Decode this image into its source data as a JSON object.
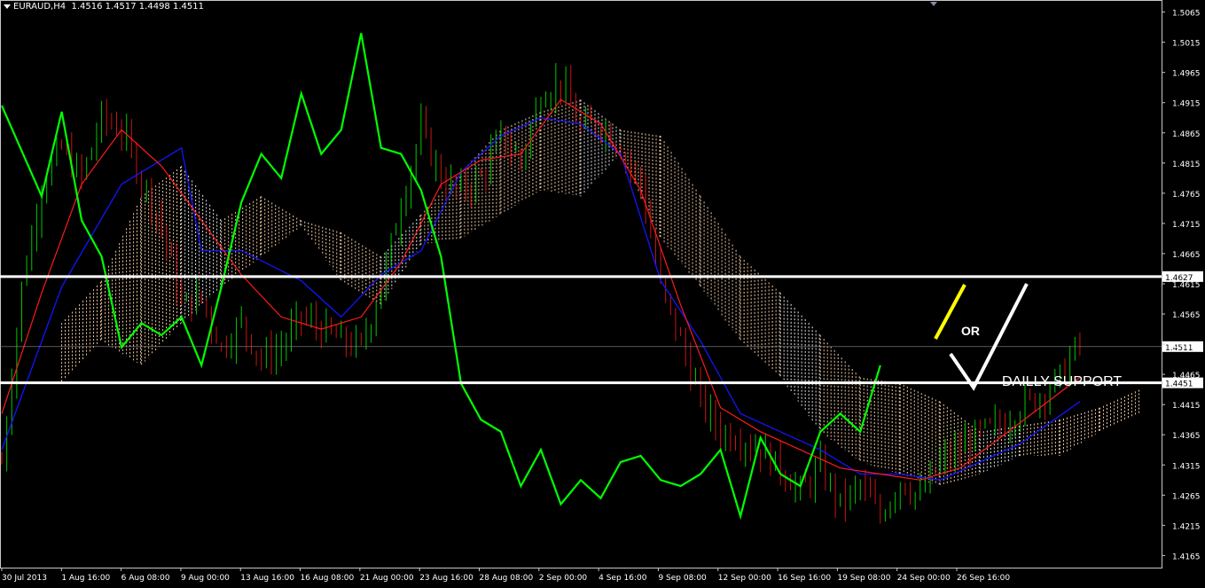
{
  "header": {
    "symbol": "EURAUD,H4",
    "ohlc": "1.4516 1.4517 1.4498 1.4511"
  },
  "colors": {
    "background": "#000000",
    "candle_up": "#00c800",
    "candle_down": "#c81414",
    "tenkan": "#ff1a1a",
    "kijun": "#1414ff",
    "chikou": "#00ff00",
    "cloud_bull": "#f0c8a0",
    "cloud_bear": "#e6e6e6",
    "levels": "#ffffff",
    "arrow_yellow": "#ffff00"
  },
  "chart_data": {
    "type": "candlestick",
    "instrument": "EURAUD",
    "timeframe": "H4",
    "ylim": [
      1.4145,
      1.5085
    ],
    "y_ticks": [
      "1.5065",
      "1.5015",
      "1.4965",
      "1.4915",
      "1.4865",
      "1.4815",
      "1.4765",
      "1.4715",
      "1.4665",
      "1.4615",
      "1.4565",
      "1.4515",
      "1.4465",
      "1.4415",
      "1.4365",
      "1.4315",
      "1.4265",
      "1.4215",
      "1.4165"
    ],
    "x_ticks": [
      "30 Jul 2013",
      "1 Aug 16:00",
      "6 Aug 08:00",
      "9 Aug 00:00",
      "13 Aug 16:00",
      "16 Aug 08:00",
      "21 Aug 00:00",
      "23 Aug 16:00",
      "28 Aug 08:00",
      "2 Sep 00:00",
      "4 Sep 16:00",
      "9 Sep 08:00",
      "12 Sep 00:00",
      "16 Sep 16:00",
      "19 Sep 08:00",
      "24 Sep 00:00",
      "26 Sep 16:00"
    ],
    "current_price": "1.4511",
    "levels": [
      {
        "price": 1.4627,
        "label": "1.4627"
      },
      {
        "price": 1.4451,
        "label": "1.4451"
      }
    ],
    "annotations": {
      "or": "OR",
      "support": "DAILLY SUPPORT"
    },
    "price_path": [
      [
        0,
        1.432
      ],
      [
        1,
        1.461
      ],
      [
        2,
        1.478
      ],
      [
        3,
        1.484
      ],
      [
        4,
        1.479
      ],
      [
        5,
        1.489
      ],
      [
        6,
        1.487
      ],
      [
        7,
        1.479
      ],
      [
        8,
        1.471
      ],
      [
        9,
        1.458
      ],
      [
        10,
        1.459
      ],
      [
        11,
        1.451
      ],
      [
        12,
        1.455
      ],
      [
        13,
        1.449
      ],
      [
        14,
        1.451
      ],
      [
        15,
        1.456
      ],
      [
        16,
        1.454
      ],
      [
        17,
        1.452
      ],
      [
        18,
        1.451
      ],
      [
        19,
        1.461
      ],
      [
        20,
        1.475
      ],
      [
        21,
        1.487
      ],
      [
        22,
        1.479
      ],
      [
        23,
        1.477
      ],
      [
        24,
        1.479
      ],
      [
        25,
        1.486
      ],
      [
        26,
        1.482
      ],
      [
        27,
        1.493
      ],
      [
        28,
        1.495
      ],
      [
        29,
        1.487
      ],
      [
        30,
        1.488
      ],
      [
        31,
        1.484
      ],
      [
        32,
        1.478
      ],
      [
        33,
        1.461
      ],
      [
        34,
        1.452
      ],
      [
        35,
        1.442
      ],
      [
        36,
        1.437
      ],
      [
        37,
        1.436
      ],
      [
        38,
        1.434
      ],
      [
        39,
        1.431
      ],
      [
        40,
        1.427
      ],
      [
        41,
        1.431
      ],
      [
        42,
        1.425
      ],
      [
        43,
        1.428
      ],
      [
        44,
        1.423
      ],
      [
        45,
        1.429
      ],
      [
        46,
        1.426
      ],
      [
        47,
        1.432
      ],
      [
        48,
        1.434
      ],
      [
        49,
        1.437
      ],
      [
        50,
        1.438
      ],
      [
        51,
        1.441
      ],
      [
        52,
        1.443
      ],
      [
        53,
        1.446
      ],
      [
        54,
        1.452
      ]
    ],
    "tenkan": [
      [
        0,
        1.44
      ],
      [
        2,
        1.46
      ],
      [
        4,
        1.478
      ],
      [
        6,
        1.487
      ],
      [
        8,
        1.481
      ],
      [
        10,
        1.472
      ],
      [
        12,
        1.463
      ],
      [
        14,
        1.456
      ],
      [
        16,
        1.454
      ],
      [
        18,
        1.456
      ],
      [
        20,
        1.465
      ],
      [
        22,
        1.478
      ],
      [
        24,
        1.482
      ],
      [
        26,
        1.483
      ],
      [
        28,
        1.492
      ],
      [
        30,
        1.488
      ],
      [
        32,
        1.477
      ],
      [
        34,
        1.458
      ],
      [
        36,
        1.441
      ],
      [
        38,
        1.437
      ],
      [
        40,
        1.434
      ],
      [
        42,
        1.431
      ],
      [
        44,
        1.43
      ],
      [
        46,
        1.429
      ],
      [
        48,
        1.431
      ],
      [
        50,
        1.436
      ],
      [
        52,
        1.441
      ],
      [
        54,
        1.446
      ]
    ],
    "kijun": [
      [
        0,
        1.434
      ],
      [
        3,
        1.461
      ],
      [
        6,
        1.478
      ],
      [
        9,
        1.484
      ],
      [
        10,
        1.467
      ],
      [
        12,
        1.467
      ],
      [
        15,
        1.462
      ],
      [
        17,
        1.456
      ],
      [
        19,
        1.463
      ],
      [
        21,
        1.467
      ],
      [
        23,
        1.48
      ],
      [
        25,
        1.486
      ],
      [
        27,
        1.489
      ],
      [
        29,
        1.488
      ],
      [
        31,
        1.483
      ],
      [
        33,
        1.462
      ],
      [
        35,
        1.452
      ],
      [
        37,
        1.44
      ],
      [
        39,
        1.437
      ],
      [
        41,
        1.434
      ],
      [
        43,
        1.43
      ],
      [
        45,
        1.43
      ],
      [
        47,
        1.429
      ],
      [
        49,
        1.432
      ],
      [
        51,
        1.435
      ],
      [
        54,
        1.442
      ]
    ],
    "chikou": [
      [
        0,
        1.491
      ],
      [
        2,
        1.476
      ],
      [
        3,
        1.49
      ],
      [
        4,
        1.472
      ],
      [
        5,
        1.466
      ],
      [
        6,
        1.451
      ],
      [
        7,
        1.455
      ],
      [
        8,
        1.453
      ],
      [
        9,
        1.456
      ],
      [
        10,
        1.448
      ],
      [
        11,
        1.461
      ],
      [
        12,
        1.475
      ],
      [
        13,
        1.483
      ],
      [
        14,
        1.479
      ],
      [
        15,
        1.493
      ],
      [
        16,
        1.483
      ],
      [
        17,
        1.487
      ],
      [
        18,
        1.503
      ],
      [
        19,
        1.484
      ],
      [
        20,
        1.483
      ],
      [
        21,
        1.477
      ],
      [
        22,
        1.466
      ],
      [
        23,
        1.445
      ],
      [
        24,
        1.439
      ],
      [
        25,
        1.437
      ],
      [
        26,
        1.428
      ],
      [
        27,
        1.434
      ],
      [
        28,
        1.425
      ],
      [
        29,
        1.429
      ],
      [
        30,
        1.426
      ],
      [
        31,
        1.432
      ],
      [
        32,
        1.433
      ],
      [
        33,
        1.429
      ],
      [
        34,
        1.428
      ],
      [
        35,
        1.43
      ],
      [
        36,
        1.434
      ],
      [
        37,
        1.423
      ],
      [
        38,
        1.436
      ],
      [
        39,
        1.43
      ],
      [
        40,
        1.428
      ],
      [
        41,
        1.437
      ],
      [
        42,
        1.44
      ],
      [
        43,
        1.437
      ],
      [
        44,
        1.448
      ]
    ],
    "cloud": [
      [
        3,
        1.445,
        1.455
      ],
      [
        5,
        1.452,
        1.462
      ],
      [
        7,
        1.448,
        1.476
      ],
      [
        9,
        1.455,
        1.481
      ],
      [
        11,
        1.461,
        1.472
      ],
      [
        13,
        1.466,
        1.476
      ],
      [
        15,
        1.471,
        1.472
      ],
      [
        17,
        1.462,
        1.47
      ],
      [
        19,
        1.458,
        1.466
      ],
      [
        21,
        1.468,
        1.473
      ],
      [
        23,
        1.469,
        1.48
      ],
      [
        25,
        1.473,
        1.487
      ],
      [
        27,
        1.477,
        1.49
      ],
      [
        29,
        1.476,
        1.492
      ],
      [
        31,
        1.483,
        1.487
      ],
      [
        33,
        1.469,
        1.486
      ],
      [
        35,
        1.461,
        1.476
      ],
      [
        37,
        1.452,
        1.466
      ],
      [
        39,
        1.446,
        1.46
      ],
      [
        41,
        1.437,
        1.453
      ],
      [
        43,
        1.432,
        1.446
      ],
      [
        45,
        1.43,
        1.445
      ],
      [
        47,
        1.428,
        1.442
      ],
      [
        49,
        1.43,
        1.437
      ],
      [
        51,
        1.433,
        1.438
      ],
      [
        53,
        1.433,
        1.439
      ],
      [
        55,
        1.437,
        1.441
      ],
      [
        57,
        1.44,
        1.444
      ]
    ]
  }
}
